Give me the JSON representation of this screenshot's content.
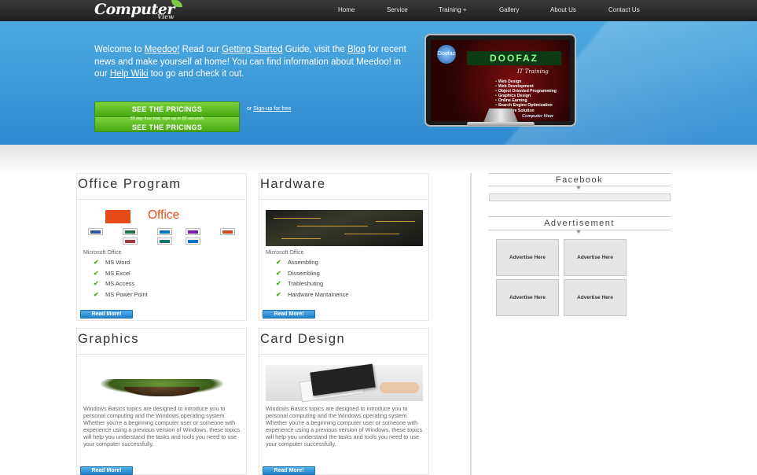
{
  "nav": {
    "logo_main": "Computer",
    "logo_sub": "View",
    "items": [
      "Home",
      "Service",
      "Training +",
      "Gallery",
      "About Us",
      "Contact Us"
    ]
  },
  "hero": {
    "intro": {
      "p1": "Welcome to ",
      "link1": "Meedoo!",
      "p2": " Read our ",
      "link2": "Getting Started",
      "p3": " Guide, visit the ",
      "link3": "Blog",
      "p4": " for recent news and make yourself at home! You can find information about Meedoo! in our ",
      "link4": "Help Wiki",
      "p5": " too go and check it out."
    },
    "pricing_button": "SEE THE PRICINGS",
    "pricing_sub": "30 day free trial, sign up in 60 seconds",
    "signup_prefix": "or ",
    "signup_link": "Sign-up for free",
    "screen": {
      "logo": "Doofaz",
      "brand": "DOOFAZ",
      "subtitle": "IT Training",
      "list": [
        "Web Design",
        "Web Development",
        "Object Oriented Programming",
        "Graphics Design",
        "Online Earning",
        "Search Engine Optimization",
        "Hardware Solution"
      ],
      "footer": "Computer View"
    }
  },
  "cards": [
    {
      "title": "Office Program",
      "office_word": "Office",
      "category": "Microsoft Office",
      "items": [
        "MS Word",
        "MS Excel",
        "MS Access",
        "MS Power Point"
      ],
      "button": "Read More!"
    },
    {
      "title": "Hardware",
      "category": "Microsoft Office",
      "items": [
        "Assembling",
        "Dissembling",
        "Trableshuting",
        "Hardware Mantainence"
      ],
      "button": "Read More!"
    },
    {
      "title": "Graphics",
      "text": "Windows Basics topics are designed to introduce you to personal computing and the Windows operating system. Whether you're a beginning computer user or someone with experience using a previous version of Windows, these topics will help you understand the tasks and tools you need to use your computer successfully.",
      "button": "Read More!"
    },
    {
      "title": "Card Design",
      "text": "Windows Basics topics are designed to introduce you to personal computing and the Windows operating system. Whether you're a beginning computer user or someone with experience using a previous version of Windows, these topics will help you understand the tasks and tools you need to use your computer successfully.",
      "button": "Read More!"
    }
  ],
  "sidebar": {
    "facebook_title": "Facebook",
    "ad_title": "Advertisement",
    "ads": [
      "Advertise Here",
      "Advertise Here",
      "Advertise Here",
      "Advertise Here"
    ]
  },
  "colors": {
    "hero_blue": "#3a97d8",
    "green_button": "#5cbf22",
    "read_more_blue": "#2b8fd6",
    "office_orange": "#e64a19",
    "check_green": "#4aa81f"
  },
  "icons": {
    "check": "check-icon",
    "caret": "caret-down-icon"
  }
}
